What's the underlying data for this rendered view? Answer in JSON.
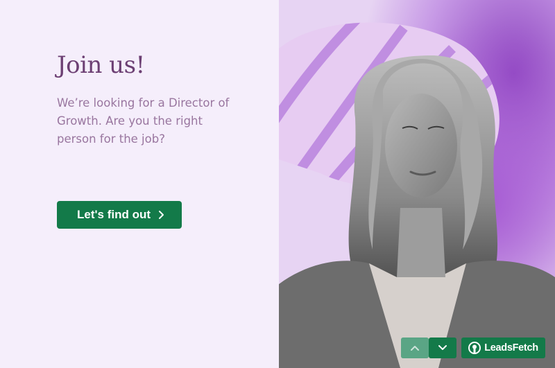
{
  "hero": {
    "title": "Join us!",
    "description": "We’re looking for a Director of Growth. Are you the right person for the job?",
    "cta_label": "Let's find out"
  },
  "photo": {
    "subject": "woman-portrait-monochrome",
    "accent": "#a05fc8"
  },
  "navigation": {
    "up_icon": "chevron-up-icon",
    "down_icon": "chevron-down-icon"
  },
  "branding": {
    "badge_label": "LeadsFetch"
  },
  "colors": {
    "background": "#f5eefb",
    "title": "#6c3f73",
    "body_text": "#99769f",
    "button": "#137a49",
    "button_disabled": "#5aa585",
    "purple_accent": "#b07fd8"
  }
}
